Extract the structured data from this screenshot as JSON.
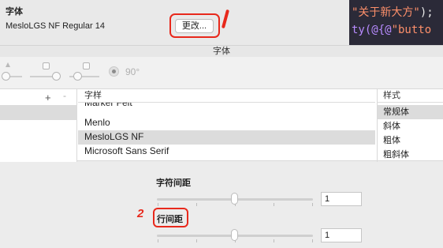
{
  "prefs": {
    "font_heading": "字体",
    "font_value": "MesloLGS NF Regular 14",
    "change_button": "更改..."
  },
  "annotations": {
    "mark1": "/",
    "mark2": "2"
  },
  "code": {
    "line1_str": "\"关于新大方\"",
    "line1_end": ");",
    "line2_fn": "ty",
    "line2_mid": "(@{@",
    "line2_str": "\"butto"
  },
  "panel": {
    "title": "字体",
    "angle": "90°",
    "collections": {
      "add": "+",
      "remove": "-"
    },
    "family_header": "字样",
    "families": [
      "Marker Felt",
      "Menlo",
      "MesloLGS NF",
      "Microsoft Sans Serif"
    ],
    "selected_family": "MesloLGS NF",
    "style_header": "样式",
    "styles": [
      "常规体",
      "斜体",
      "粗体",
      "粗斜体"
    ],
    "selected_style": "常规体",
    "char_spacing_label": "字符间距",
    "char_spacing_value": "1",
    "line_spacing_label": "行间距",
    "line_spacing_value": "1"
  },
  "colors": {
    "accent_annotation": "#e8291c",
    "code_bg": "#2b2a38"
  }
}
